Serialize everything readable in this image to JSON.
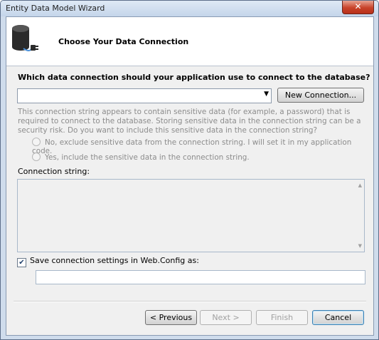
{
  "window": {
    "title": "Entity Data Model Wizard",
    "close_glyph": "✕"
  },
  "header": {
    "title": "Choose Your Data Connection",
    "icon": "database-plug-icon"
  },
  "question": "Which data connection should your application use to connect to the database?",
  "connection_select": {
    "value": "",
    "arrow": "▼"
  },
  "new_connection_label": "New Connection...",
  "sensitive_notice": "This connection string appears to contain sensitive data (for example, a password) that is required to connect to the database. Storing sensitive data in the connection string can be a security risk. Do you want to include this sensitive data in the connection string?",
  "radio_options": [
    {
      "label": "No, exclude sensitive data from the connection string. I will set it in my application code.",
      "selected": false,
      "enabled": false
    },
    {
      "label": "Yes, include the sensitive data in the connection string.",
      "selected": false,
      "enabled": false
    }
  ],
  "connection_string_label": "Connection string:",
  "connection_string_value": "",
  "save_settings": {
    "label": "Save connection settings in Web.Config as:",
    "checked": true,
    "check_glyph": "✔"
  },
  "config_name_value": "",
  "buttons": {
    "previous": "< Previous",
    "next": "Next >",
    "finish": "Finish",
    "cancel": "Cancel"
  },
  "colors": {
    "title_bar": "#c4d5ea",
    "close_button": "#c8432a",
    "disabled_text": "#8c8c8c"
  }
}
